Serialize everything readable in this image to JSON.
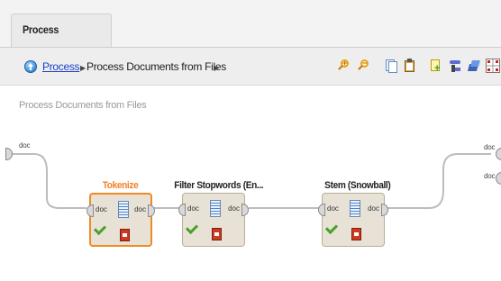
{
  "tabs": [
    {
      "label": "Process"
    }
  ],
  "breadcrumb": {
    "root": "Process",
    "current": "Process Documents from Files"
  },
  "toolbar_icons": [
    "zoom-in-icon",
    "zoom-out-icon",
    "copy-icon",
    "paste-icon",
    "new-building-block-icon",
    "route-icon",
    "layers-icon",
    "grid-icon"
  ],
  "canvas": {
    "title": "Process Documents from Files",
    "input_port": "doc",
    "output_ports": [
      "doc",
      "doc"
    ]
  },
  "operators": [
    {
      "name": "Tokenize",
      "in": "doc",
      "out": "doc",
      "selected": true
    },
    {
      "name": "Filter Stopwords (En...",
      "in": "doc",
      "out": "doc",
      "selected": false
    },
    {
      "name": "Stem (Snowball)",
      "in": "doc",
      "out": "doc",
      "selected": false
    }
  ],
  "colors": {
    "selected": "#f08a24",
    "link": "#1a3fcc",
    "status_ok": "#4aa02c"
  }
}
